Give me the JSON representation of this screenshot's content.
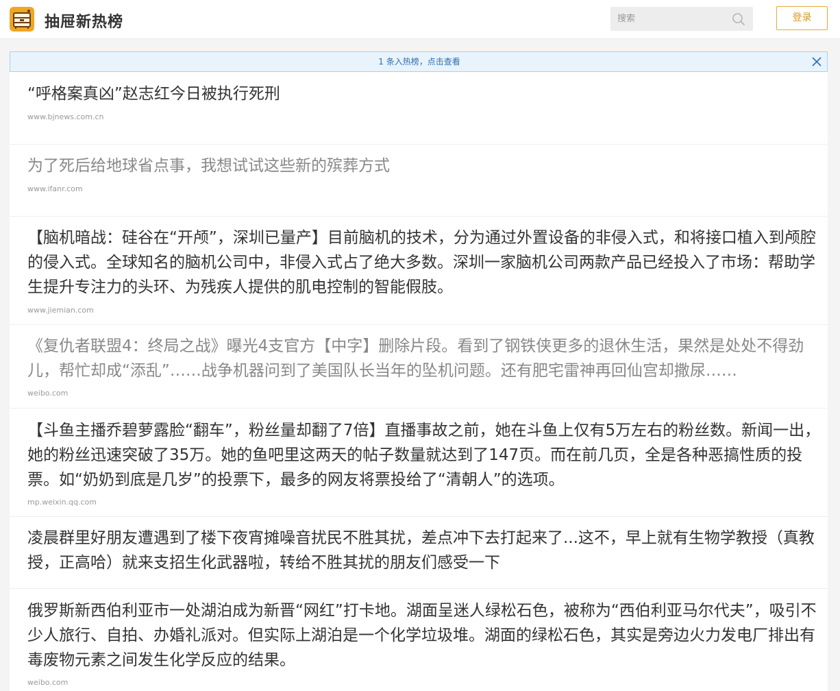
{
  "app": {
    "title": "抽屉新热榜",
    "brand_color": "#f0a623"
  },
  "search": {
    "placeholder": "搜索",
    "value": ""
  },
  "header": {
    "login_label": "登录"
  },
  "notice": {
    "text": "1 条入热榜，点击查看",
    "color": "#e8f3fc"
  },
  "items": [
    {
      "title": "“呼格案真凶”赵志红今日被执行死刑",
      "source": "www.bjnews.com.cn",
      "visited": false
    },
    {
      "title": "为了死后给地球省点事，我想试试这些新的殡葬方式",
      "source": "www.ifanr.com",
      "visited": true
    },
    {
      "title": "【脑机暗战：硅谷在“开颅”，深圳已量产】目前脑机的技术，分为通过外置设备的非侵入式，和将接口植入到颅腔的侵入式。全球知名的脑机公司中，非侵入式占了绝大多数。深圳一家脑机公司两款产品已经投入了市场：帮助学生提升专注力的头环、为残疾人提供的肌电控制的智能假肢。",
      "source": "www.jiemian.com",
      "visited": false
    },
    {
      "title": "《复仇者联盟4：终局之战》曝光4支官方【中字】删除片段。看到了钢铁侠更多的退休生活，果然是处处不得劲儿，帮忙却成“添乱”……战争机器问到了美国队长当年的坠机问题。还有肥宅雷神再回仙宫却撒尿……",
      "source": "weibo.com",
      "visited": true
    },
    {
      "title": "【斗鱼主播乔碧萝露脸“翻车”，粉丝量却翻了7倍】直播事故之前，她在斗鱼上仅有5万左右的粉丝数。新闻一出，她的粉丝迅速突破了35万。她的鱼吧里这两天的帖子数量就达到了147页。而在前几页，全是各种恶搞性质的投票。如“奶奶到底是几岁”的投票下，最多的网友将票投给了“清朝人”的选项。",
      "source": "mp.weixin.qq.com",
      "visited": false
    },
    {
      "title": "凌晨群里好朋友遭遇到了楼下夜宵摊噪音扰民不胜其扰，差点冲下去打起来了...这不，早上就有生物学教授（真教授，正高哈）就来支招生化武器啦，转给不胜其扰的朋友们感受一下",
      "source": "",
      "visited": false
    },
    {
      "title": "俄罗斯新西伯利亚市一处湖泊成为新晋“网红”打卡地。湖面呈迷人绿松石色，被称为“西伯利亚马尔代夫”，吸引不少人旅行、自拍、办婚礼派对。但实际上湖泊是一个化学垃圾堆。湖面的绿松石色，其实是旁边火力发电厂排出有毒废物元素之间发生化学反应的结果。",
      "source": "weibo.com",
      "visited": false
    }
  ]
}
